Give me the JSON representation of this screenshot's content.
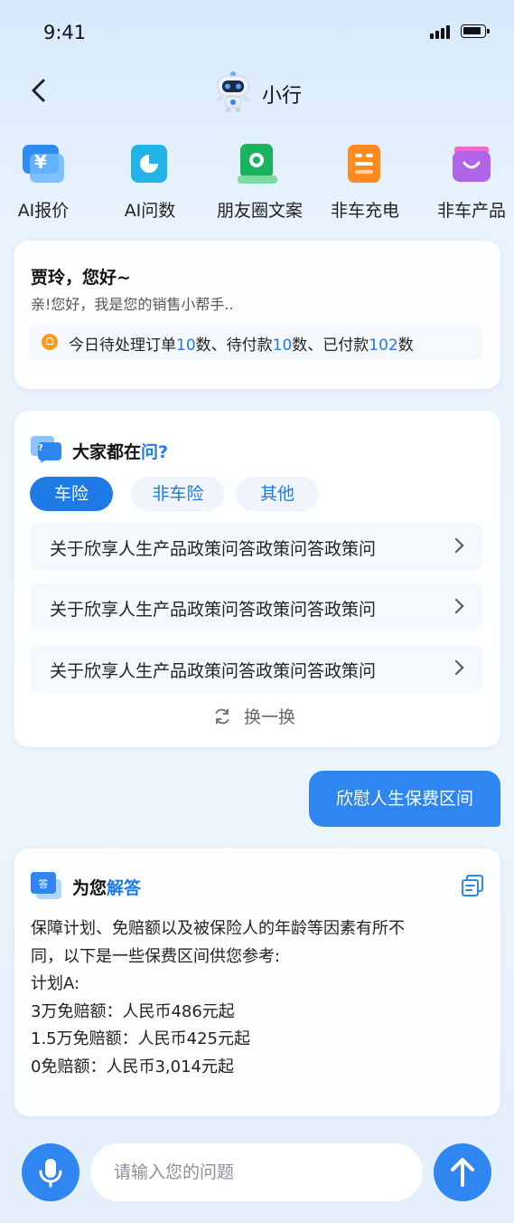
{
  "status_bar": {
    "time": "9:41"
  },
  "nav": {
    "title": "小行"
  },
  "tools": [
    {
      "label": "AI报价",
      "icon": "yuan-icon",
      "color": "#2f8cf2"
    },
    {
      "label": "AI问数",
      "icon": "chart-icon",
      "color": "#22b3e8"
    },
    {
      "label": "朋友圈文案",
      "icon": "moments-icon",
      "color": "#19b45c"
    },
    {
      "label": "非车充电",
      "icon": "list-icon",
      "color": "#ff8a1e"
    },
    {
      "label": "非车产品",
      "icon": "bag-icon",
      "color": "#b064e8"
    }
  ],
  "greeting": {
    "name": "贾玲，您好~",
    "subtitle": "亲!您好，我是您的销售小帮手..",
    "notice_prefix": "今日待处理订单",
    "pending_orders": "10",
    "notice_mid1": "数、待付款",
    "pending_payment": "10",
    "notice_mid2": "数、已付款",
    "paid": "102",
    "notice_suffix": "数"
  },
  "faq": {
    "title_prefix": "大家都在",
    "title_highlight": "问?",
    "tabs": [
      "车险",
      "非车险",
      "其他"
    ],
    "questions": [
      "关于欣享人生产品政策问答政策问答政策问",
      "关于欣享人生产品政策问答政策问答政策问",
      "关于欣享人生产品政策问答政策问答政策问"
    ],
    "refresh_label": "换一换"
  },
  "user_message": "欣慰人生保费区间",
  "answer": {
    "title_prefix": "为您",
    "title_highlight": "解答",
    "lines": [
      "保障计划、免赔额以及被保险人的年龄等因素有所不",
      "同，以下是一些保费区间供您参考:",
      "计划A:",
      "3万免赔额：人民币486元起",
      "1.5万免赔额：人民币425元起",
      "0免赔额：人民币3,014元起"
    ]
  },
  "input": {
    "placeholder": "请输入您的问题"
  },
  "colors": {
    "accent": "#1e7be6",
    "bubble": "#2f86f0"
  }
}
